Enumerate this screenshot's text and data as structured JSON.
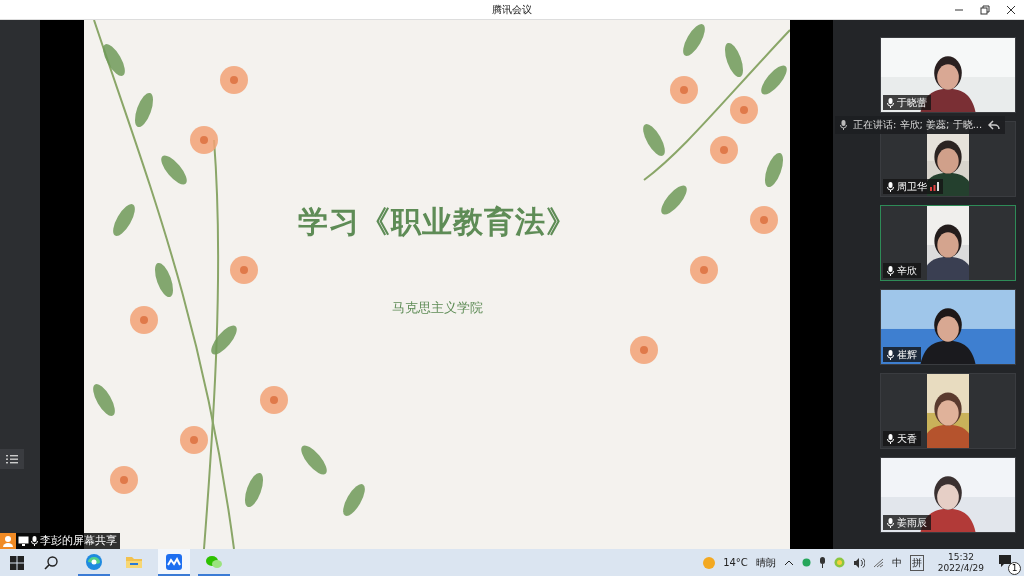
{
  "window": {
    "title": "腾讯会议"
  },
  "slide": {
    "title": "学习《职业教育法》",
    "subtitle": "马克思主义学院"
  },
  "share_label": "李彭的屏幕共享",
  "speaking": "正在讲话: 辛欣; 姜蕊; 于晓...",
  "participants": [
    {
      "name": "于晓蕾",
      "kind": "wide",
      "selected": false,
      "talking": false
    },
    {
      "name": "周卫华",
      "kind": "portrait",
      "selected": false,
      "talking": true
    },
    {
      "name": "辛欣",
      "kind": "portrait",
      "selected": true,
      "talking": false
    },
    {
      "name": "崔辉",
      "kind": "wide",
      "selected": false,
      "talking": false
    },
    {
      "name": "天香",
      "kind": "portrait",
      "selected": false,
      "talking": false
    },
    {
      "name": "姜雨辰",
      "kind": "wide",
      "selected": false,
      "talking": false
    }
  ],
  "taskbar": {
    "apps": [
      {
        "kind": "edge",
        "selected": false,
        "running": true
      },
      {
        "kind": "folder",
        "selected": false,
        "running": false
      },
      {
        "kind": "meeting",
        "selected": true,
        "running": true
      },
      {
        "kind": "wechat",
        "selected": false,
        "running": true
      }
    ],
    "weather": {
      "temp": "14°C",
      "text": "晴朗"
    },
    "ime": [
      "中",
      "拼"
    ],
    "time": "15:32",
    "date": "2022/4/29",
    "notifications": "1"
  }
}
